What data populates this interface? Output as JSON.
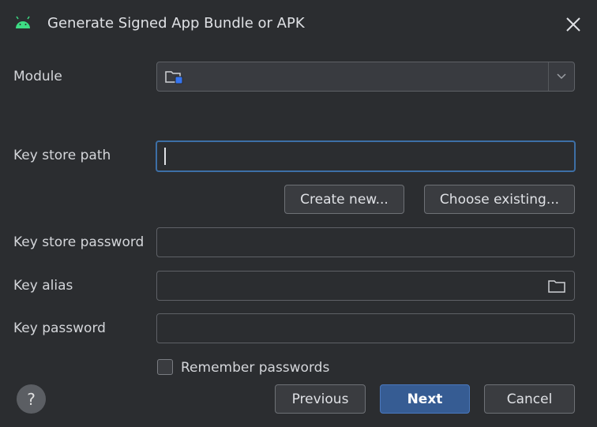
{
  "window": {
    "title": "Generate Signed App Bundle or APK"
  },
  "icons": {
    "app": "android-icon",
    "close": "close-icon",
    "module": "module-folder-icon",
    "dropdown": "chevron-down-icon",
    "browse": "folder-icon",
    "help": "help-icon"
  },
  "module": {
    "label": "Module",
    "value": ""
  },
  "keystore": {
    "path_label": "Key store path",
    "path_value": "",
    "create_label": "Create new...",
    "choose_label": "Choose existing...",
    "password_label": "Key store password",
    "password_value": ""
  },
  "key": {
    "alias_label": "Key alias",
    "alias_value": "",
    "password_label": "Key password",
    "password_value": ""
  },
  "remember": {
    "label": "Remember passwords",
    "checked": false
  },
  "footer": {
    "help_label": "?",
    "previous_label": "Previous",
    "next_label": "Next",
    "cancel_label": "Cancel"
  },
  "colors": {
    "background": "#2b2d30",
    "accent": "#365c93",
    "focus_border": "#3d6fa6"
  }
}
